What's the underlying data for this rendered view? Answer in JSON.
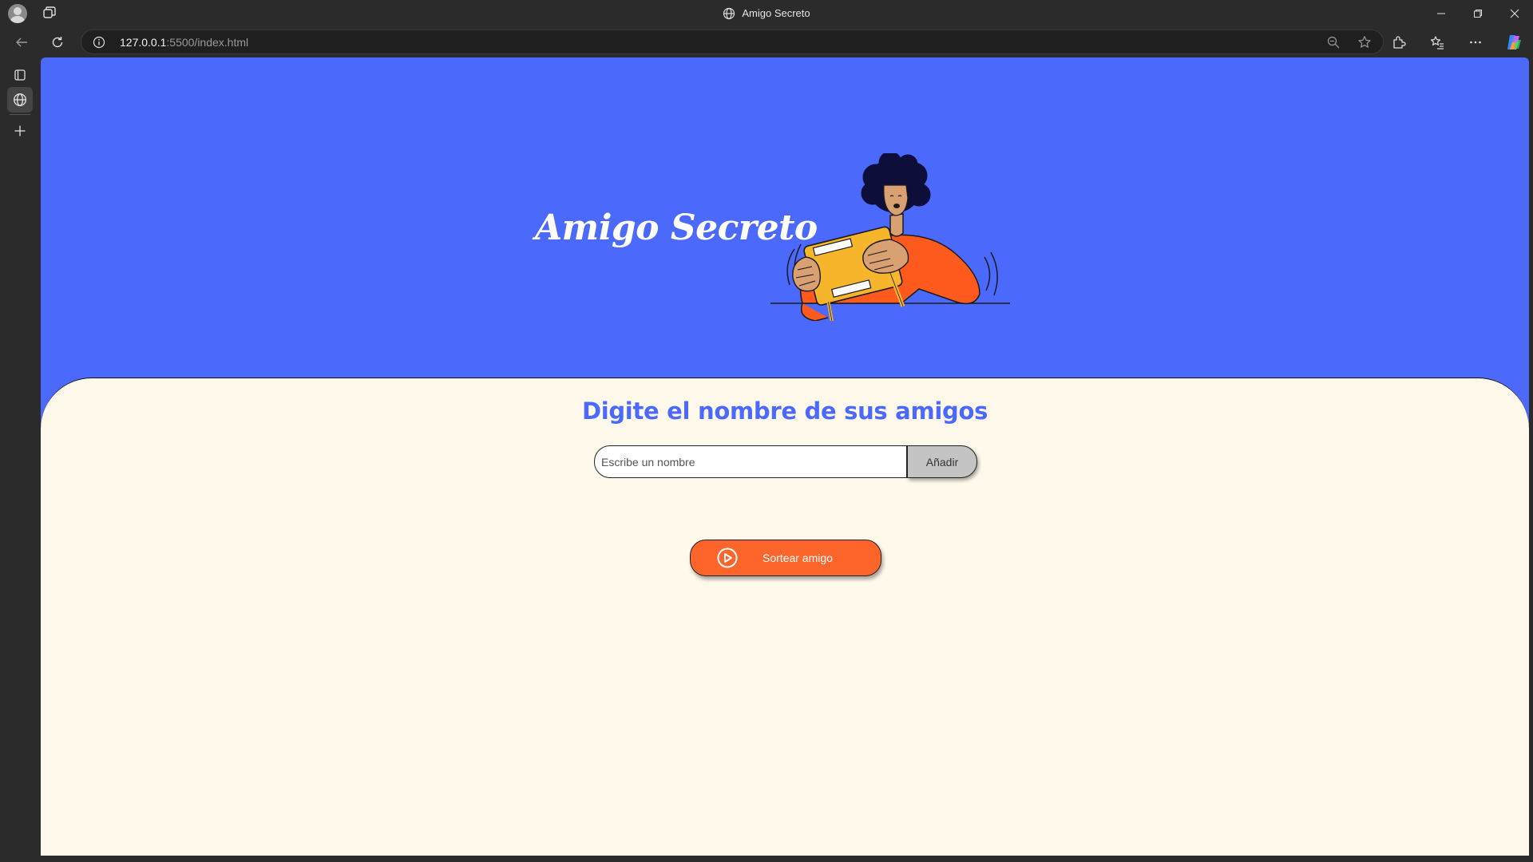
{
  "browser": {
    "tab_title": "Amigo Secreto",
    "url_host": "127.0.0.1",
    "url_rest": ":5500/index.html"
  },
  "page": {
    "header_title": "Amigo Secreto",
    "section_title": "Digite el nombre de sus amigos",
    "input_placeholder": "Escribe un nombre",
    "input_value": "",
    "add_button_label": "Añadir",
    "draw_button_label": "Sortear amigo"
  },
  "colors": {
    "primary_blue": "#4b69fd",
    "accent_orange": "#fe652b",
    "cream_background": "#fff9eb",
    "add_button_gray": "#c4c4c4"
  },
  "icons": {
    "draw_button": "play-circle-icon",
    "address_info": "info-icon",
    "tab_favicon": "globe-icon"
  }
}
